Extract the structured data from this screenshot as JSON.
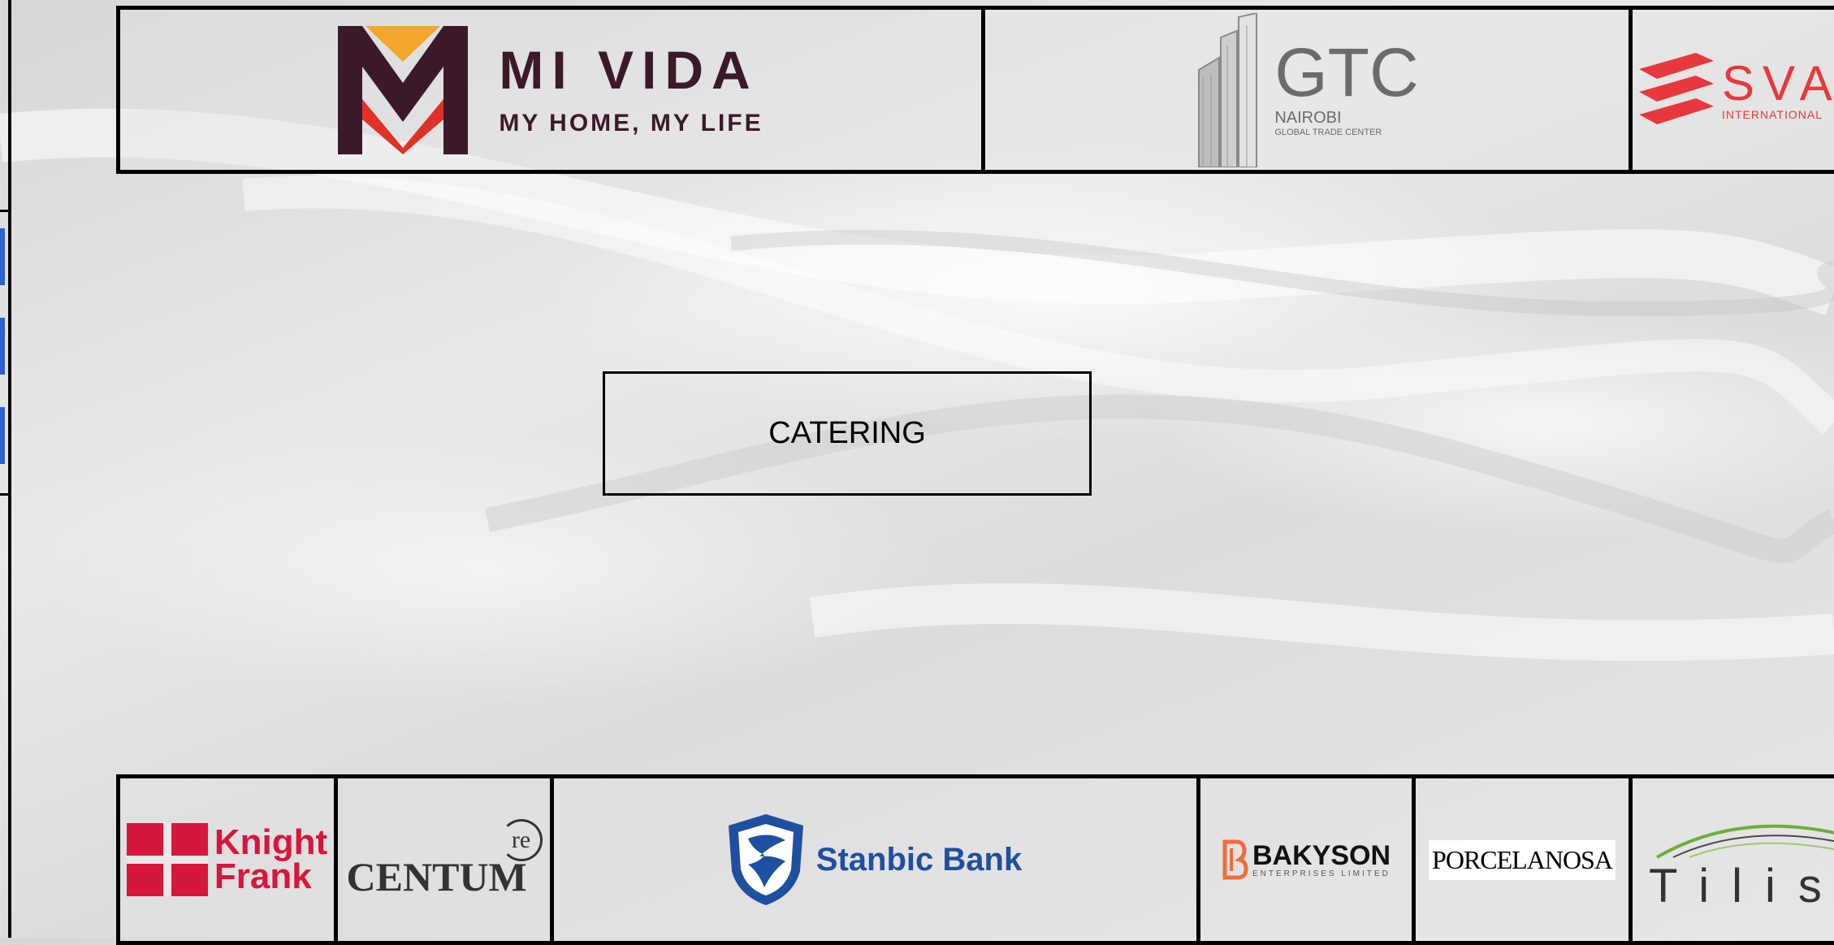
{
  "area_label": "CATERING",
  "top_row": [
    {
      "name": "mi-vida",
      "title": "MI VIDA",
      "tagline": "MY HOME, MY LIFE"
    },
    {
      "name": "gtc",
      "title": "GTC",
      "line1": "NAIROBI",
      "line2": "GLOBAL TRADE CENTER"
    },
    {
      "name": "sva",
      "title": "SVA",
      "line1": "INTERNATIONAL"
    }
  ],
  "bottom_row": [
    {
      "name": "knight-frank",
      "line1": "Knight",
      "line2": "Frank"
    },
    {
      "name": "centum",
      "title": "CENTUM",
      "mark": "re"
    },
    {
      "name": "stanbic",
      "title": "Stanbic Bank"
    },
    {
      "name": "bakyson",
      "title": "BAKYSON",
      "line1": "ENTERPRISES LIMITED"
    },
    {
      "name": "porcelanosa",
      "title": "PORCELANOSA"
    },
    {
      "name": "tilisi",
      "title": "Tilisi"
    }
  ],
  "colors": {
    "mi_vida_maroon": "#3a1a2a",
    "mi_vida_orange": "#f4a62a",
    "mi_vida_red": "#e03127",
    "sva_red": "#e8383d",
    "knight_frank_red": "#d6163d",
    "stanbic_blue": "#1f4fa0",
    "bakyson_orange": "#f26b3a",
    "tilisi_green": "#6fae3a"
  }
}
